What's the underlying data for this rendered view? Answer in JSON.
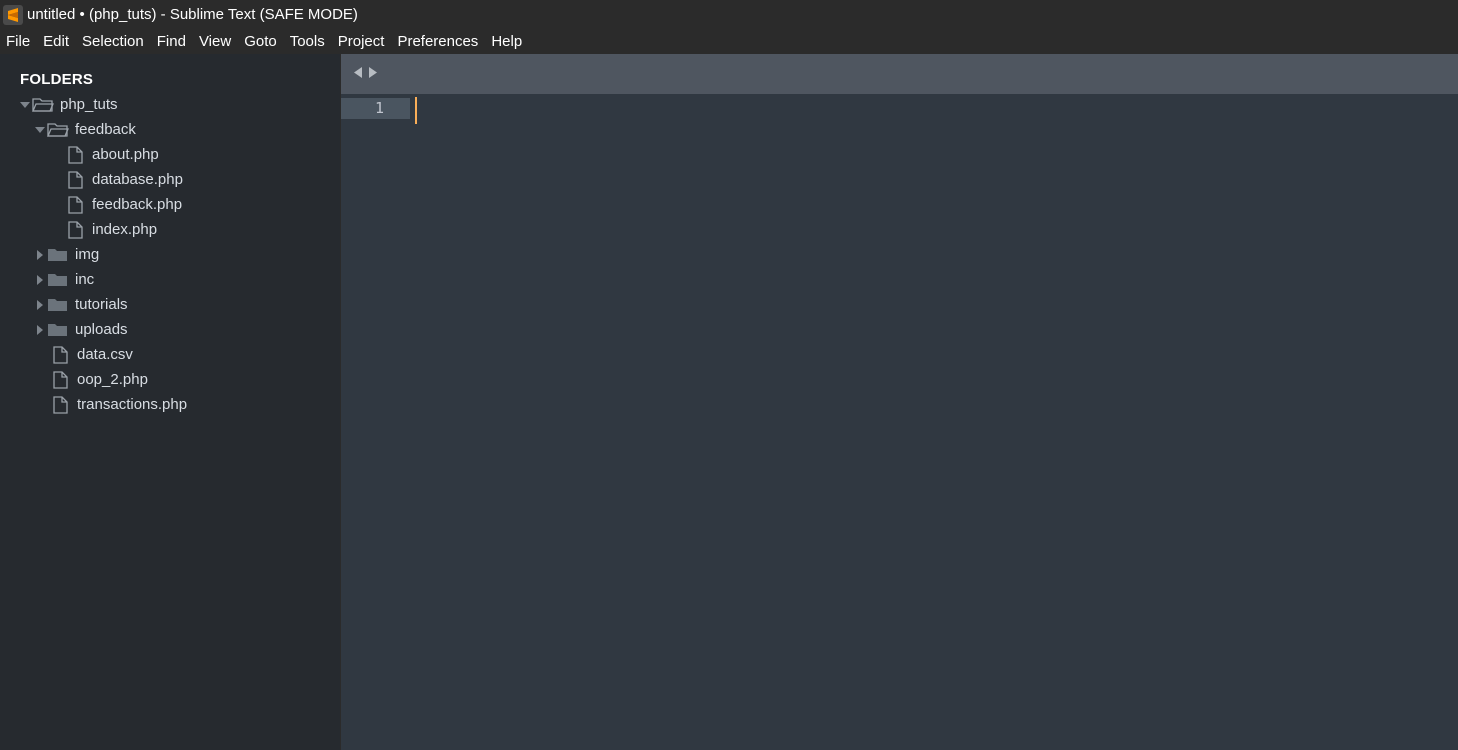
{
  "window": {
    "title": "untitled • (php_tuts) - Sublime Text (SAFE MODE)"
  },
  "menu": [
    "File",
    "Edit",
    "Selection",
    "Find",
    "View",
    "Goto",
    "Tools",
    "Project",
    "Preferences",
    "Help"
  ],
  "sidebar": {
    "header": "FOLDERS",
    "tree": [
      {
        "label": "php_tuts",
        "kind": "folder",
        "expanded": true,
        "depth": 0
      },
      {
        "label": "feedback",
        "kind": "folder",
        "expanded": true,
        "depth": 1
      },
      {
        "label": "about.php",
        "kind": "file",
        "depth": 2
      },
      {
        "label": "database.php",
        "kind": "file",
        "depth": 2
      },
      {
        "label": "feedback.php",
        "kind": "file",
        "depth": 2
      },
      {
        "label": "index.php",
        "kind": "file",
        "depth": 2
      },
      {
        "label": "img",
        "kind": "folder",
        "expanded": false,
        "depth": 1
      },
      {
        "label": "inc",
        "kind": "folder",
        "expanded": false,
        "depth": 1
      },
      {
        "label": "tutorials",
        "kind": "folder",
        "expanded": false,
        "depth": 1
      },
      {
        "label": "uploads",
        "kind": "folder",
        "expanded": false,
        "depth": 1
      },
      {
        "label": "data.csv",
        "kind": "file",
        "depth": 1
      },
      {
        "label": "oop_2.php",
        "kind": "file",
        "depth": 1
      },
      {
        "label": "transactions.php",
        "kind": "file",
        "depth": 1
      }
    ]
  },
  "editor": {
    "line_number": "1"
  },
  "colors": {
    "accent_caret": "#f9ae58",
    "sidebar_bg": "#262a2f",
    "editor_bg": "#303841",
    "tabbar_bg": "#4f5660"
  }
}
